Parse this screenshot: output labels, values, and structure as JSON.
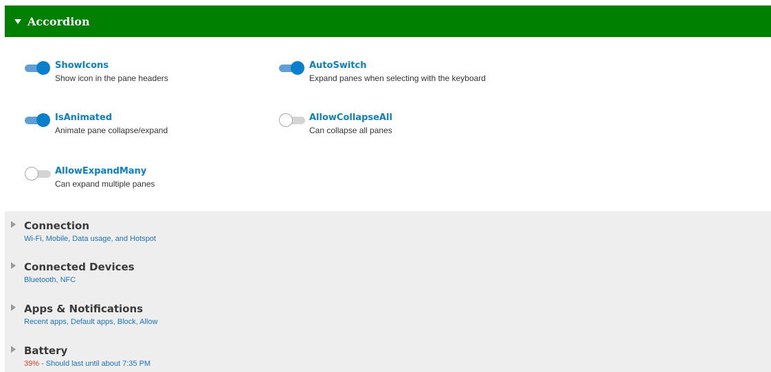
{
  "accordion": {
    "title": "Accordion",
    "expanded": true
  },
  "options": [
    {
      "name": "ShowIcons",
      "description": "Show icon in the pane headers",
      "checked": true
    },
    {
      "name": "AutoSwitch",
      "description": "Expand panes when selecting with the keyboard",
      "checked": true
    },
    {
      "name": "IsAnimated",
      "description": "Animate pane collapse/expand",
      "checked": true
    },
    {
      "name": "AllowCollapseAll",
      "description": "Can collapse all panes",
      "checked": false
    },
    {
      "name": "AllowExpandMany",
      "description": "Can expand multiple panes",
      "checked": false
    }
  ],
  "panes": [
    {
      "title": "Connection",
      "subtitle": "Wi-Fi, Mobile, Data usage, and Hotspot"
    },
    {
      "title": "Connected Devices",
      "subtitle": "Bluetooth, NFC"
    },
    {
      "title": "Apps & Notifications",
      "subtitle": "Recent apps, Default apps, Block, Allow"
    },
    {
      "title": "Battery",
      "subtitle_highlight": "39%",
      "subtitle": " - Should last until about 7:35 PM"
    }
  ],
  "colors": {
    "header_bg": "#008000",
    "accent": "#0a7fcc",
    "pane_bg": "#eeeeee",
    "subtitle": "#1a73c4",
    "warning": "#e0402a"
  },
  "icons": {
    "header_expander": "triangle-down-icon",
    "pane_expander": "triangle-right-icon"
  }
}
